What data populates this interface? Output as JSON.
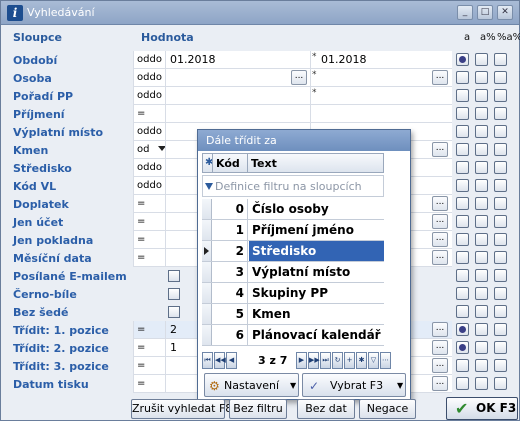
{
  "window": {
    "title": "Vyhledávání"
  },
  "header": {
    "col_columns": "Sloupce",
    "col_value": "Hodnota",
    "col_a": "a",
    "col_a_pct": "a%",
    "col_pct_a_pct": "%a%"
  },
  "rows": [
    {
      "label": "Období",
      "op": "oddo",
      "v1": "01.2018",
      "v2": "01.2018",
      "star": "*"
    },
    {
      "label": "Osoba",
      "op": "oddo",
      "v1": "",
      "v2": "",
      "star": "*"
    },
    {
      "label": "Pořadí PP",
      "op": "oddo",
      "v1": "",
      "v2": "",
      "star": "*"
    },
    {
      "label": "Příjmení",
      "op": "=",
      "v1": "",
      "v2": "",
      "star": ""
    },
    {
      "label": "Výplatní místo",
      "op": "oddo",
      "v1": "",
      "v2": "",
      "star": ""
    },
    {
      "label": "Kmen",
      "op": "od",
      "v1": "",
      "v2": "",
      "star": ""
    },
    {
      "label": "Středisko",
      "op": "oddo",
      "v1": "",
      "v2": "",
      "star": ""
    },
    {
      "label": "Kód VL",
      "op": "oddo",
      "v1": "",
      "v2": "",
      "star": ""
    },
    {
      "label": "Doplatek",
      "op": "=",
      "v1": "",
      "v2": "",
      "star": ""
    },
    {
      "label": "Jen účet",
      "op": "=",
      "v1": "",
      "v2": "",
      "star": ""
    },
    {
      "label": "Jen pokladna",
      "op": "=",
      "v1": "",
      "v2": "",
      "star": ""
    },
    {
      "label": "Měsíční data",
      "op": "=",
      "v1": "",
      "v2": "",
      "star": ""
    },
    {
      "label": "Posílané E-mailem",
      "op": "",
      "v1": "",
      "v2": "",
      "star": ""
    },
    {
      "label": "Černo-bíle",
      "op": "",
      "v1": "",
      "v2": "",
      "star": ""
    },
    {
      "label": "Bez šedé",
      "op": "",
      "v1": "",
      "v2": "",
      "star": ""
    },
    {
      "label": "Třídit: 1. pozice",
      "op": "=",
      "v1": "2",
      "v2": "",
      "star": ""
    },
    {
      "label": "Třídit: 2. pozice",
      "op": "=",
      "v1": "1",
      "v2": "",
      "star": ""
    },
    {
      "label": "Třídit: 3. pozice",
      "op": "=",
      "v1": "",
      "v2": "",
      "star": ""
    },
    {
      "label": "Datum tisku",
      "op": "=",
      "v1": "",
      "v2": "",
      "star": ""
    }
  ],
  "popup": {
    "title": "Dále třídit za",
    "col_kod": "Kód",
    "col_text": "Text",
    "filter_placeholder": "Definice filtru na sloupcích",
    "items": [
      {
        "kod": "0",
        "text": "Číslo osoby"
      },
      {
        "kod": "1",
        "text": "Příjmení jméno"
      },
      {
        "kod": "2",
        "text": "Středisko"
      },
      {
        "kod": "3",
        "text": "Výplatní místo"
      },
      {
        "kod": "4",
        "text": "Skupiny PP"
      },
      {
        "kod": "5",
        "text": "Kmen"
      },
      {
        "kod": "6",
        "text": "Plánovací kalendář"
      }
    ],
    "position": "3 z 7",
    "settings_label": "Nastavení",
    "select_label": "Vybrat F3"
  },
  "buttons": {
    "cancel_search": "Zrušit vyhledat F8",
    "no_filter": "Bez filtru",
    "no_data": "Bez dat",
    "negate": "Negace",
    "ok": "OK F3"
  }
}
